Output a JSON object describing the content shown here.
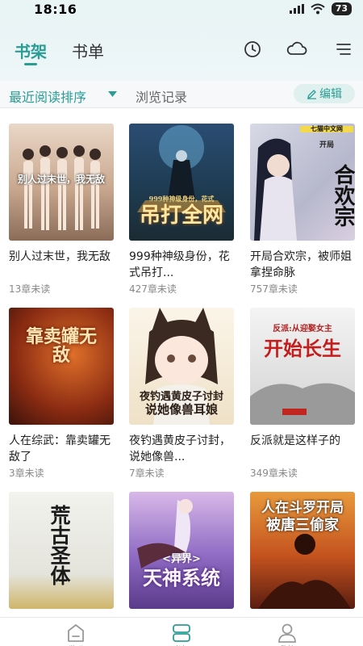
{
  "status_bar": {
    "time": "18:16",
    "battery": "73"
  },
  "header": {
    "tabs": [
      {
        "label": "书架"
      },
      {
        "label": "书单"
      }
    ],
    "icons": [
      "clock-icon",
      "cloud-icon",
      "menu-icon"
    ]
  },
  "toolbar": {
    "sort_label": "最近阅读排序",
    "history_label": "浏览记录",
    "edit_label": "编辑"
  },
  "books": [
    {
      "title": "别人过末世，我无敌",
      "unread": "13章未读",
      "cover_text": "别人过末世，我无敌"
    },
    {
      "title": "999种神级身份，花式吊打...",
      "unread": "427章未读",
      "cover_text": "吊打全网",
      "cover_subtext": "999种神级身份，花式"
    },
    {
      "title": "开局合欢宗，被师姐拿捏命脉",
      "unread": "757章未读",
      "cover_text": "合欢宗",
      "cover_badge": "七猫中文网",
      "cover_subtext": "开局"
    },
    {
      "title": "人在综武：靠卖罐无敌了",
      "unread": "3章未读",
      "cover_text": "靠卖罐无敌"
    },
    {
      "title": "夜钓遇黄皮子讨封，说她像兽...",
      "unread": "7章未读",
      "cover_text": "夜钓遇黄皮子讨封",
      "cover_text2": "说她像兽耳娘"
    },
    {
      "title": "反派就是这样子的",
      "unread": "349章未读",
      "cover_text": "开始长生",
      "cover_subtext": "反派:从迎娶女主"
    },
    {
      "title": "荒古圣体",
      "unread": "",
      "cover_text": "荒古圣体"
    },
    {
      "title": "异界天神系统",
      "unread": "",
      "cover_text": "天神系统",
      "cover_subtext": "<异界>"
    },
    {
      "title": "人在斗罗开局被唐三偷家",
      "unread": "",
      "cover_text": "人在斗罗开局",
      "cover_text2": "被唐三偷家"
    }
  ],
  "bottom_nav": {
    "items": [
      {
        "label": "发现"
      },
      {
        "label": "书架"
      },
      {
        "label": "我的"
      }
    ]
  }
}
